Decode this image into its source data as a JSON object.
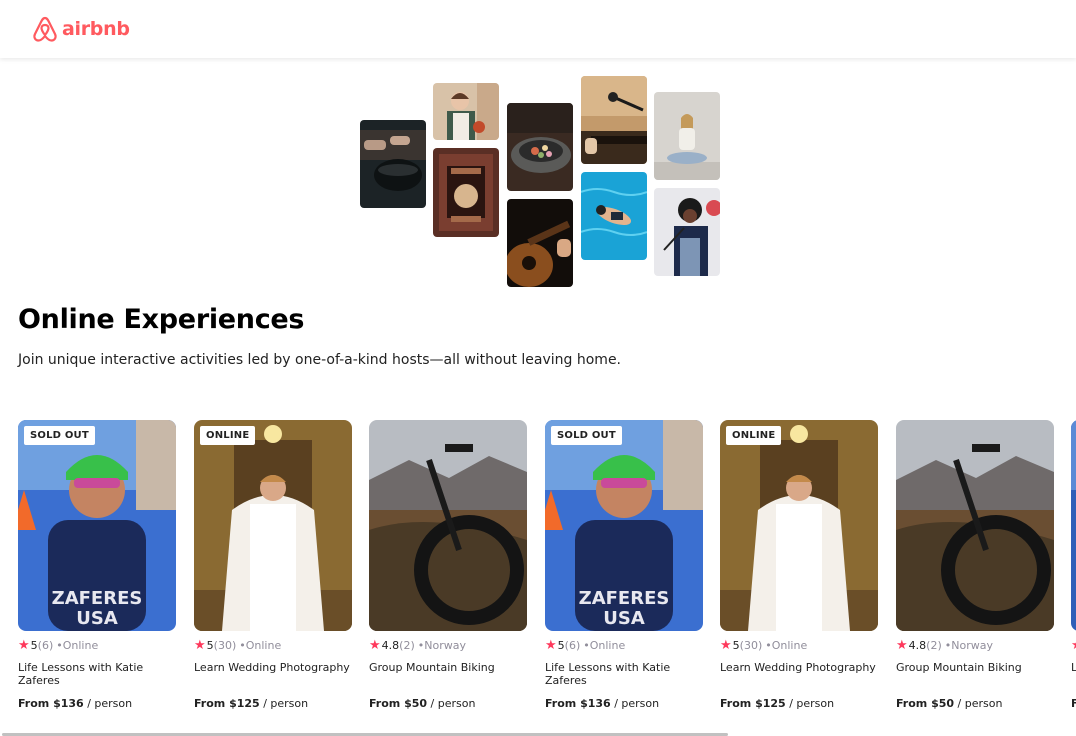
{
  "brand": {
    "name": "airbnb",
    "color": "#FF5A5F",
    "icon": "airbnb-logo-icon"
  },
  "hero": {
    "title": "Online Experiences",
    "subtitle": "Join unique interactive activities led by one-of-a-kind hosts—all without leaving home."
  },
  "colors": {
    "star": "#FE395C",
    "muted": "#918E9B",
    "text": "#222222"
  },
  "cards": [
    {
      "badge": "SOLD OUT",
      "rating": "5",
      "reviews": "(6)",
      "location": "•Online",
      "title": "Life Lessons with Katie Zaferes",
      "price_prefix": "From $136",
      "price_suffix": " / person"
    },
    {
      "badge": "ONLINE",
      "rating": "5",
      "reviews": "(30)",
      "location": "•Online",
      "title": "Learn Wedding Photography",
      "price_prefix": "From $125",
      "price_suffix": " / person"
    },
    {
      "badge": "",
      "rating": "4.8",
      "reviews": "(2)",
      "location": "•Norway",
      "title": "Group Mountain Biking",
      "price_prefix": "From $50",
      "price_suffix": " / person"
    },
    {
      "badge": "SOLD OUT",
      "rating": "5",
      "reviews": "(6)",
      "location": "•Online",
      "title": "Life Lessons with Katie Zaferes",
      "price_prefix": "From $136",
      "price_suffix": " / person"
    },
    {
      "badge": "ONLINE",
      "rating": "5",
      "reviews": "(30)",
      "location": "•Online",
      "title": "Learn Wedding Photography",
      "price_prefix": "From $125",
      "price_suffix": " / person"
    },
    {
      "badge": "",
      "rating": "4.8",
      "reviews": "(2)",
      "location": "•Norway",
      "title": "Group Mountain Biking",
      "price_prefix": "From $50",
      "price_suffix": " / person"
    },
    {
      "badge": "",
      "rating": "",
      "reviews": "",
      "location": "",
      "title": "L Z",
      "price_prefix": "F",
      "price_suffix": ""
    }
  ]
}
